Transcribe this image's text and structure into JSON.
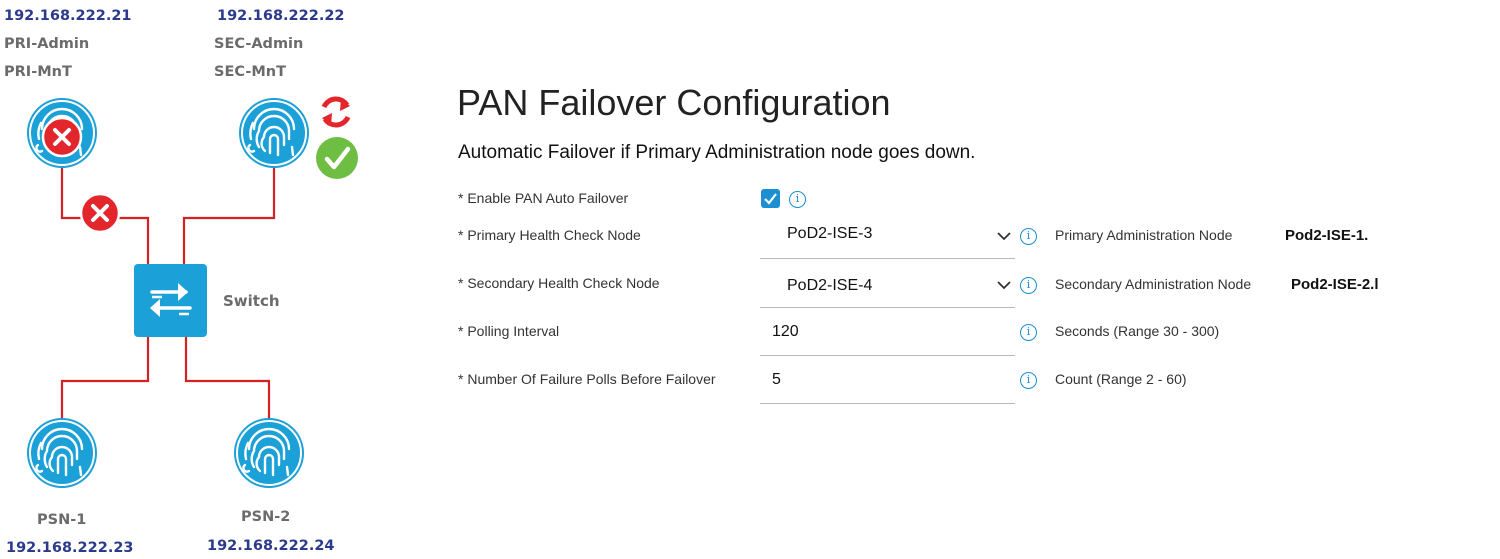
{
  "diagram": {
    "pri": {
      "ip": "192.168.222.21",
      "roles": [
        "PRI-Admin",
        "PRI-MnT"
      ],
      "state": "down"
    },
    "sec": {
      "ip": "192.168.222.22",
      "roles": [
        "SEC-Admin",
        "SEC-MnT"
      ],
      "state": "promoted"
    },
    "switch_label": "Switch",
    "psn1": {
      "name": "PSN-1",
      "ip": "192.168.222.23"
    },
    "psn2": {
      "name": "PSN-2",
      "ip": "192.168.222.24"
    },
    "colors": {
      "node": "#1ba0d8",
      "link": "#d42121",
      "fail": "#e3262c",
      "ok": "#6fbe44",
      "sync": "#e3262c",
      "ip": "#2b3a8c"
    },
    "icons": {
      "node": "fingerprint-icon",
      "fail": "x-circle-icon",
      "ok": "check-circle-icon",
      "sync": "sync-arrows-icon",
      "switch": "switch-arrows-icon"
    }
  },
  "form": {
    "title": "PAN Failover Configuration",
    "subtitle": "Automatic Failover if Primary Administration node goes down.",
    "enable": {
      "label": "* Enable PAN Auto Failover",
      "checked": true
    },
    "primary": {
      "label": "* Primary Health Check Node",
      "value": "PoD2-ISE-3",
      "hint_label": "Primary Administration Node",
      "hint_value": "Pod2-ISE-1."
    },
    "secondary": {
      "label": "* Secondary Health Check Node",
      "value": "PoD2-ISE-4",
      "hint_label": "Secondary Administration Node",
      "hint_value": "Pod2-ISE-2.l"
    },
    "polling": {
      "label": "* Polling Interval",
      "value": "120",
      "hint": "Seconds (Range 30 - 300)"
    },
    "failures": {
      "label": "* Number Of Failure Polls Before Failover",
      "value": "5",
      "hint": "Count (Range 2 - 60)"
    },
    "accent": "#1b8fd1"
  }
}
